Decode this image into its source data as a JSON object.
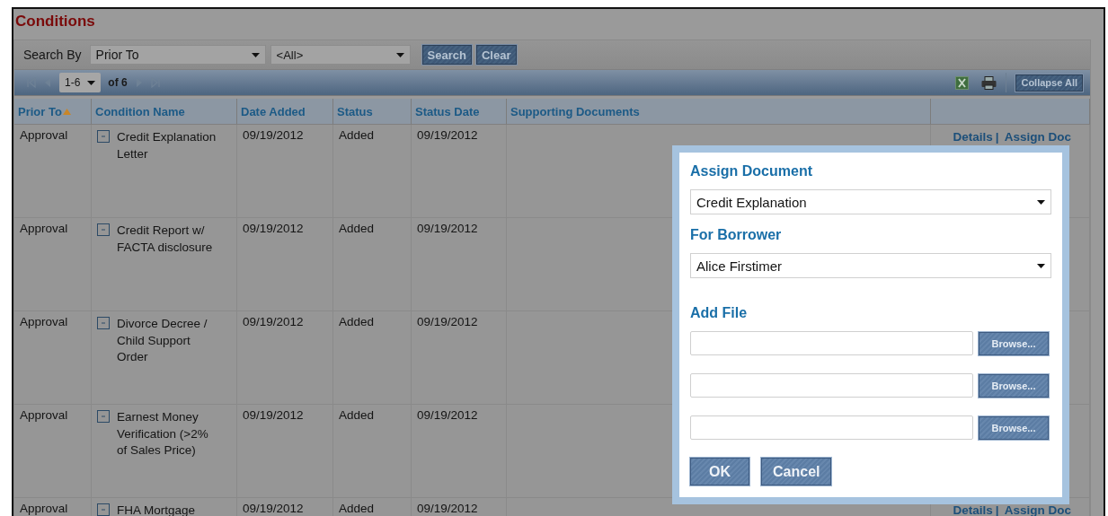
{
  "page": {
    "title": "Conditions"
  },
  "search": {
    "label": "Search By",
    "field": "Prior To",
    "value": "<All>",
    "buttons": [
      "Search",
      "Clear"
    ]
  },
  "pager": {
    "range": "1-6",
    "total": "of 6",
    "nav": [
      {
        "kind": "first",
        "disabled": true
      },
      {
        "kind": "prev",
        "disabled": true
      },
      {
        "kind": "next",
        "disabled": true
      },
      {
        "kind": "last",
        "disabled": true
      }
    ]
  },
  "toolbar": {
    "collapse_button": "Collapse All"
  },
  "table": {
    "columns": [
      {
        "label": "Prior To",
        "sorted": true
      },
      {
        "label": "Condition Name",
        "sorted": false
      },
      {
        "label": "Date Added",
        "sorted": false
      },
      {
        "label": "Status",
        "sorted": false
      },
      {
        "label": "Status Date",
        "sorted": false
      },
      {
        "label": "Supporting Documents",
        "sorted": false
      }
    ],
    "rows": [
      {
        "prior_to": "Approval",
        "condition": "Credit Explanation Letter",
        "expanded": true,
        "date_added": "09/19/2012",
        "status": "Added",
        "status_date": "09/19/2012",
        "actions": {
          "links": [
            "Details",
            "Assign Doc"
          ],
          "separator": "|"
        }
      },
      {
        "prior_to": "Approval",
        "condition": "Credit Report w/ FACTA disclosure",
        "expanded": true,
        "date_added": "09/19/2012",
        "status": "Added",
        "status_date": "09/19/2012"
      },
      {
        "prior_to": "Approval",
        "condition": "Divorce Decree / Child Support Order",
        "expanded": true,
        "date_added": "09/19/2012",
        "status": "Added",
        "status_date": "09/19/2012"
      },
      {
        "prior_to": "Approval",
        "condition": "Earnest Money Verification (>2% of Sales Price)",
        "expanded": true,
        "date_added": "09/19/2012",
        "status": "Added",
        "status_date": "09/19/2012"
      },
      {
        "prior_to": "Approval",
        "condition": "FHA Mortgage",
        "expanded": true,
        "date_added": "09/19/2012",
        "status": "Added",
        "status_date": "09/19/2012",
        "actions": {
          "links": [
            "Details",
            "Assign Doc"
          ],
          "separator": "|"
        }
      }
    ]
  },
  "dialog": {
    "title": "Assign Document",
    "document": "Credit Explanation",
    "borrower_label": "For Borrower",
    "borrower": "Alice Firstimer",
    "file_label": "Add File",
    "files": [
      {
        "button": "Browse..."
      },
      {
        "button": "Browse..."
      },
      {
        "button": "Browse..."
      }
    ],
    "buttons": [
      "OK",
      "Cancel"
    ]
  }
}
